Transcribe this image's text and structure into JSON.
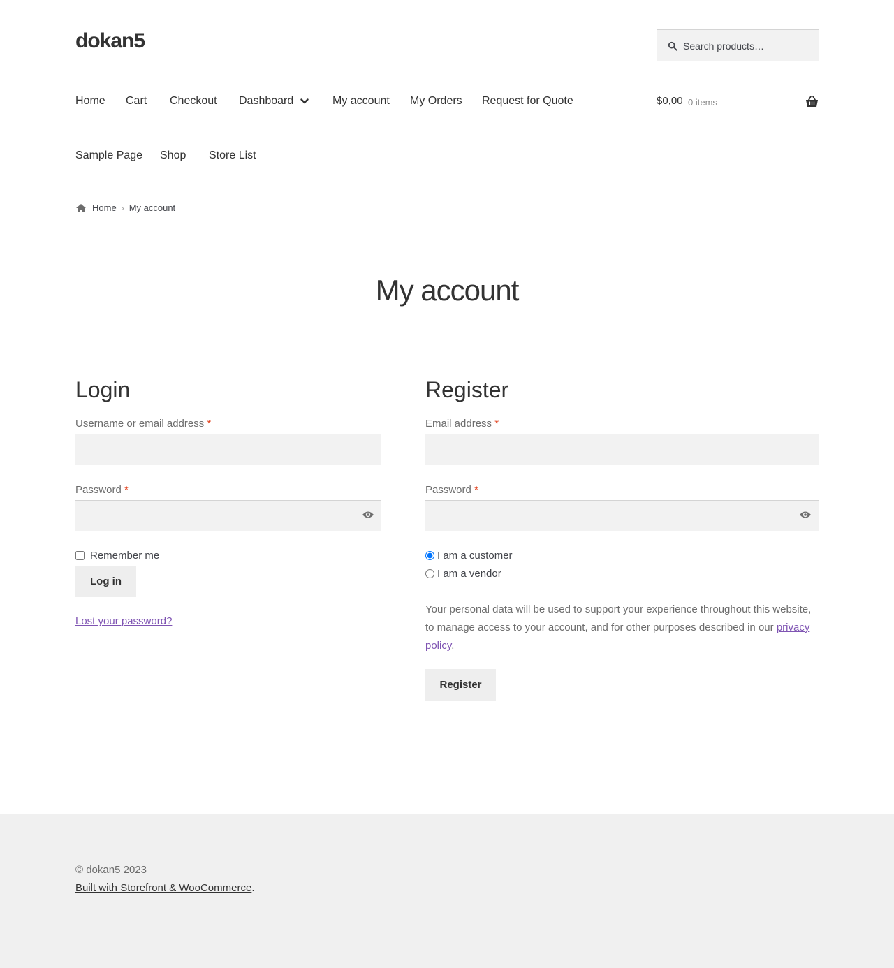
{
  "site": {
    "title": "dokan5"
  },
  "search": {
    "placeholder": "Search products…"
  },
  "nav": {
    "items": [
      {
        "label": "Home"
      },
      {
        "label": "Cart"
      },
      {
        "label": "Checkout"
      },
      {
        "label": "Dashboard"
      },
      {
        "label": "My account"
      },
      {
        "label": "My Orders"
      },
      {
        "label": "Request for Quote"
      },
      {
        "label": "Sample Page"
      },
      {
        "label": "Shop"
      },
      {
        "label": "Store List"
      }
    ]
  },
  "cart": {
    "total": "$0,00",
    "count": "0 items"
  },
  "breadcrumb": {
    "home": "Home",
    "current": "My account"
  },
  "page": {
    "title": "My account"
  },
  "login": {
    "title": "Login",
    "username_label": "Username or email address",
    "password_label": "Password",
    "required_mark": "*",
    "remember_label": "Remember me",
    "remember_checked": false,
    "submit_label": "Log in",
    "lost_password_label": "Lost your password?"
  },
  "register": {
    "title": "Register",
    "email_label": "Email address",
    "password_label": "Password",
    "required_mark": "*",
    "role_options": [
      "I am a customer",
      "I am a vendor"
    ],
    "role_selected": "I am a customer",
    "privacy_text": "Your personal data will be used to support your experience throughout this website, to manage access to your account, and for other purposes described in our",
    "privacy_link": "privacy policy",
    "privacy_end": ".",
    "submit_label": "Register"
  },
  "footer": {
    "copyright": "© dokan5 2023",
    "built_with": "Built with Storefront & WooCommerce",
    "built_with_end": "."
  },
  "colors": {
    "accent": "#7f54b3",
    "required": "#e2401c",
    "input_bg": "#f2f2f2",
    "footer_bg": "#f0f0f0"
  }
}
